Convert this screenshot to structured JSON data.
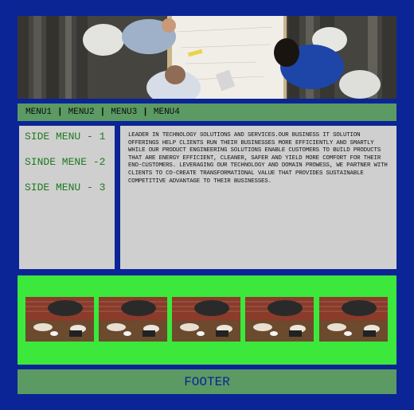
{
  "nav": {
    "items": [
      "MENU1",
      "MENU2",
      "MENU3",
      "MENU4"
    ],
    "separator": "|"
  },
  "sidebar": {
    "items": [
      "SIDE MENU - 1",
      "SINDE MENE -2",
      "SIDE MENU - 3"
    ]
  },
  "content": {
    "text": " LEADER IN TECHNOLOGY SOLUTIONS AND SERVICES.OUR BUSINESS IT SOLUTION OFFERINGS HELP CLIENTS RUN THEIR BUSINESSES MORE EFFICIENTLY AND SMARTLY WHILE OUR PRODUCT ENGINEERING SOLUTIONS ENABLE CUSTOMERS TO BUILD PRODUCTS THAT ARE ENERGY EFFICIENT, CLEANER, SAFER AND YIELD MORE COMFORT FOR THEIR END-CUSTOMERS. LEVERAGING OUR TECHNOLOGY AND DOMAIN PROWESS, WE PARTNER WITH CLIENTS TO CO-CREATE TRANSFORMATIONAL VALUE THAT PROVIDES SUSTAINABLE COMPETITIVE ADVANTAGE TO THEIR BUSINESSES."
  },
  "footer": {
    "label": "FOOTER"
  },
  "colors": {
    "page_background": "#0b2596",
    "nav_background": "#5b9a63",
    "panel_background": "#cfcfcf",
    "gallery_background": "#3be83b",
    "side_menu_text": "#1f7a1f",
    "footer_text": "#0b2596"
  }
}
